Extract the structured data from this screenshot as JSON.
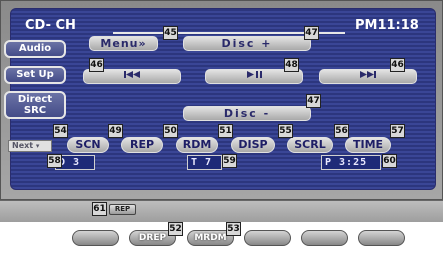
{
  "header": {
    "mode": "CD- CH",
    "clock": "PM11:18"
  },
  "buttons": {
    "menu": "Menu»",
    "disc_plus": "Disc  +",
    "disc_minus": "Disc  -",
    "prev_icon": "skip-back-icon",
    "play_pause_icon": "play-pause-icon",
    "next_icon": "skip-forward-icon"
  },
  "side": {
    "audio": "Audio",
    "setup": "Set Up",
    "direct_line1": "Direct",
    "direct_line2": "SRC"
  },
  "next_label": "Next",
  "functions": [
    "SCN",
    "REP",
    "RDM",
    "DISP",
    "SCRL",
    "TIME"
  ],
  "readouts": {
    "disc": "D 3",
    "track": "T 7",
    "play_time": "P 3:25"
  },
  "indicator": {
    "rep": "REP"
  },
  "softkeys": [
    "",
    "DREP",
    "MRDM",
    "",
    "",
    ""
  ],
  "callouts": {
    "c45a": "45",
    "c47a": "47",
    "c46a": "46",
    "c48": "48",
    "c46b": "46",
    "c47b": "47",
    "c54": "54",
    "c49": "49",
    "c50": "50",
    "c51": "51",
    "c55": "55",
    "c56": "56",
    "c57": "57",
    "c58": "58",
    "c59": "59",
    "c60": "60",
    "c61": "61",
    "c52": "52",
    "c53": "53"
  },
  "colors": {
    "screen": "#3a4696",
    "button_text": "#2a2a6a",
    "readout_bg": "#1e2a78"
  }
}
